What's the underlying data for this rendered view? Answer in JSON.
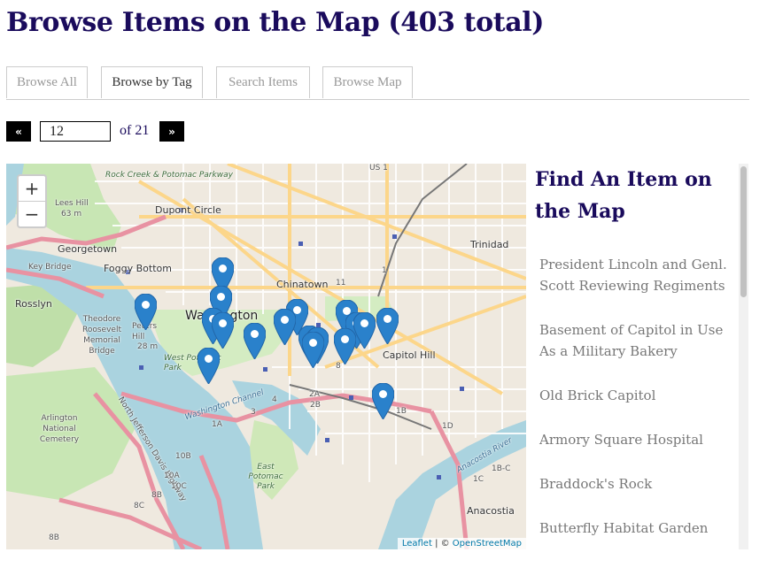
{
  "page": {
    "title": "Browse Items on the Map (403 total)"
  },
  "tabs": [
    {
      "label": "Browse All",
      "active": false
    },
    {
      "label": "Browse by Tag",
      "active": true
    },
    {
      "label": "Search Items",
      "active": false
    },
    {
      "label": "Browse Map",
      "active": false
    }
  ],
  "pagination": {
    "prev": "«",
    "next": "»",
    "current_page": "12",
    "of_label": "of 21"
  },
  "map": {
    "zoom_in": "+",
    "zoom_out": "−",
    "attribution": {
      "leaflet": "Leaflet",
      "separator": " | © ",
      "osm": "OpenStreetMap"
    },
    "labels": {
      "rock_creek": "Rock Creek & Potomac Parkway",
      "lees_hill": "Lees Hill",
      "lees_hill_elev": "63 m",
      "dupont_circle": "Dupont Circle",
      "georgetown": "Georgetown",
      "key_bridge": "Key Bridge",
      "foggy_bottom": "Foggy Bottom",
      "rosslyn": "Rosslyn",
      "theodore": "Theodore Roosevelt Memorial Bridge",
      "peters_hill": "Peters Hill",
      "peters_elev": "28 m",
      "washington": "Washington",
      "chinatown": "Chinatown",
      "trinidad": "Trinidad",
      "capitol_hill": "Capitol Hill",
      "west_potomac": "West Potomac Park",
      "washington_channel": "Washington Channel",
      "arlington_cemetery": "Arlington National Cemetery",
      "jefferson_davis": "North Jefferson Davis Highway",
      "east_potomac": "East Potomac Park",
      "anacostia_river": "Anacostia River",
      "anacostia": "Anacostia",
      "us1": "US 1",
      "r11": "11",
      "r1": "1",
      "r8": "8",
      "r2a": "2A",
      "r2b": "2B",
      "r4": "4",
      "r3": "3",
      "r1b": "1B",
      "r1d": "1D",
      "r1c": "1C",
      "r1bc": "1B-C",
      "r10b": "10B",
      "r10a": "10A",
      "r10c": "10C",
      "r8b": "8B",
      "r8c": "8C",
      "r8b2": "8B",
      "r1a": "1A"
    },
    "marker_icon": "map-pin-icon",
    "marker_color": "#2a81cb"
  },
  "sidebar": {
    "title": "Find An Item on the Map",
    "items": [
      "President Lincoln and Genl. Scott Reviewing Regiments",
      "Basement of Capitol in Use As a Military Bakery",
      "Old Brick Capitol",
      "Armory Square Hospital",
      "Braddock's Rock",
      "Butterfly Habitat Garden"
    ]
  },
  "colors": {
    "heading": "#1a0b5c",
    "tab_border": "#cccccc",
    "map_water": "#aad3df",
    "map_park": "#c8e6b4"
  }
}
